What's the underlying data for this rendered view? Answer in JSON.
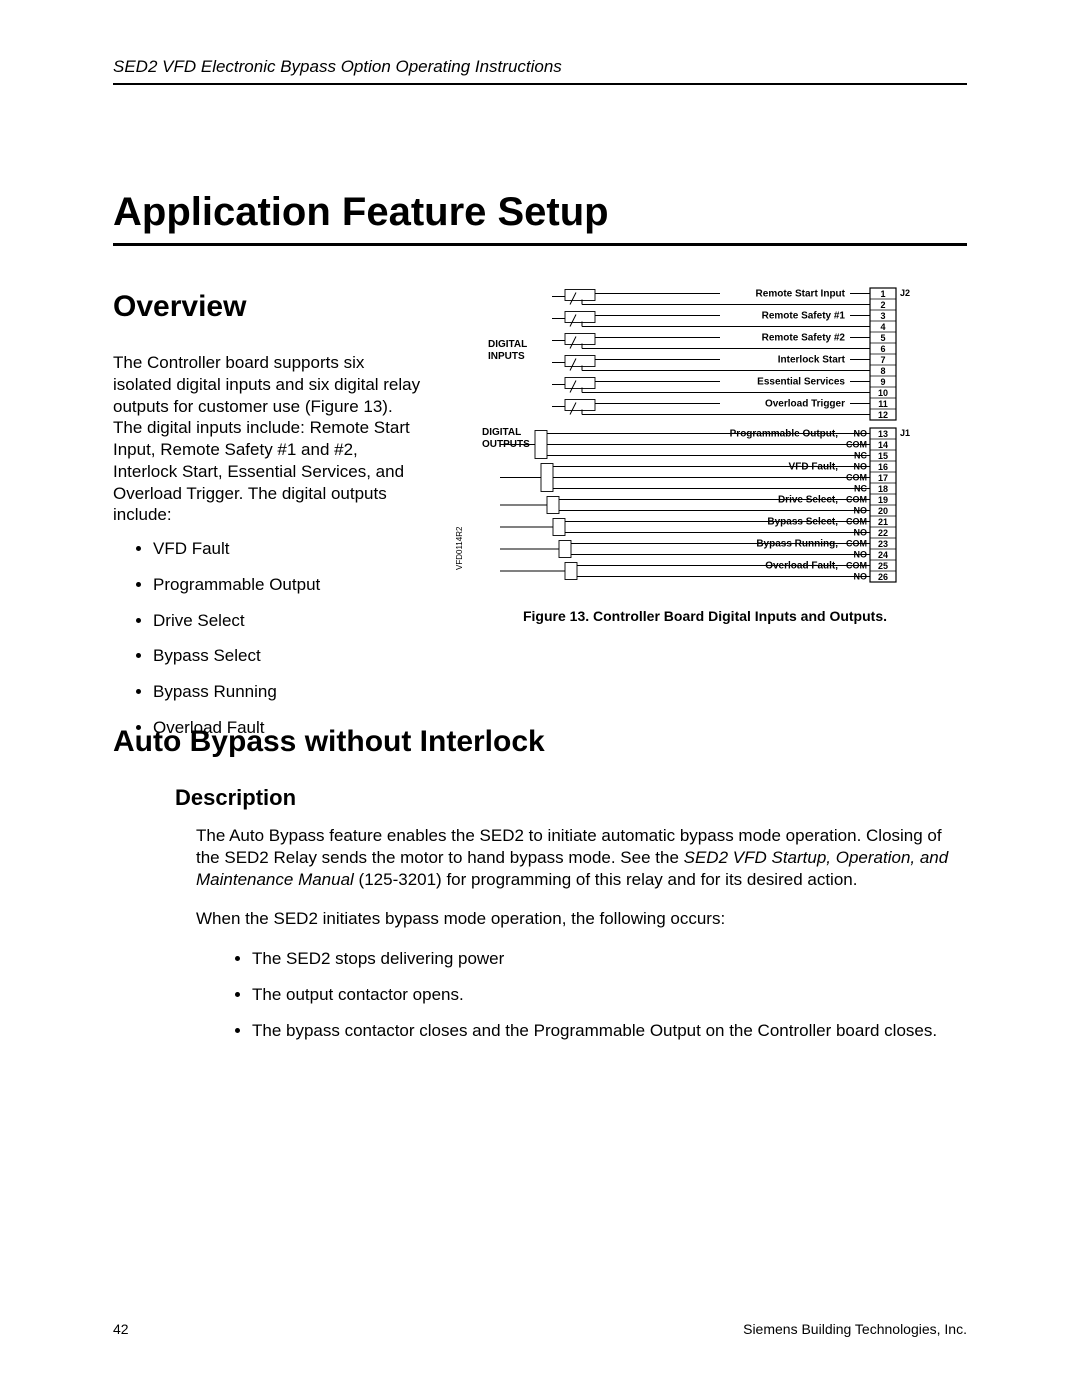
{
  "header": {
    "title": "SED2 VFD Electronic Bypass Option Operating Instructions"
  },
  "main_title": "Application Feature Setup",
  "overview": {
    "heading": "Overview",
    "paragraph": "The Controller board supports six isolated digital inputs and six digital relay outputs for customer use (Figure 13). The digital inputs include: Remote Start Input, Remote Safety #1 and #2, Interlock Start, Essential Services, and Overload Trigger. The digital outputs include:",
    "bullets": [
      "VFD Fault",
      "Programmable Output",
      "Drive Select",
      "Bypass Select",
      "Bypass Running",
      "Overload Fault"
    ]
  },
  "figure": {
    "caption": "Figure 13. Controller Board Digital Inputs and Outputs.",
    "group_inputs": "DIGITAL\nINPUTS",
    "group_outputs": "DIGITAL\nOUTPUTS",
    "conn_j2": "J2",
    "conn_j1": "J1",
    "side_label": "VFD0114R2",
    "inputs": [
      "Remote Start Input",
      "Remote Safety #1",
      "Remote Safety #2",
      "Interlock Start",
      "Essential Services",
      "Overload Trigger"
    ],
    "outputs": [
      {
        "name": "Programmable Output",
        "lines": [
          "NO",
          "COM",
          "NC"
        ]
      },
      {
        "name": "VFD Fault",
        "lines": [
          "NO",
          "COM",
          "NC"
        ]
      },
      {
        "name": "Drive Select",
        "lines": [
          "COM",
          "NO"
        ]
      },
      {
        "name": "Bypass Select",
        "lines": [
          "COM",
          "NO"
        ]
      },
      {
        "name": "Bypass Running",
        "lines": [
          "COM",
          "NO"
        ]
      },
      {
        "name": "Overload Fault",
        "lines": [
          "COM",
          "NO"
        ]
      }
    ],
    "terminals": [
      "1",
      "2",
      "3",
      "4",
      "5",
      "6",
      "7",
      "8",
      "9",
      "10",
      "11",
      "12",
      "13",
      "14",
      "15",
      "16",
      "17",
      "18",
      "19",
      "20",
      "21",
      "22",
      "23",
      "24",
      "25",
      "26"
    ]
  },
  "section2": {
    "heading": "Auto Bypass without Interlock",
    "sub": "Description",
    "para1a": "The Auto Bypass feature enables the SED2 to initiate automatic bypass mode operation. Closing of the SED2 Relay sends the motor to hand bypass mode. See the ",
    "para1b": "SED2 VFD Startup, Operation, and Maintenance Manual",
    "para1c": " (125-3201) for programming of this relay and for its desired action.",
    "para2": "When the SED2 initiates bypass mode operation, the following occurs:",
    "bullets": [
      "The SED2 stops delivering power",
      "The output contactor opens.",
      "The bypass contactor closes and the Programmable Output on the Controller board closes."
    ]
  },
  "footer": {
    "page": "42",
    "company": "Siemens Building Technologies, Inc."
  }
}
